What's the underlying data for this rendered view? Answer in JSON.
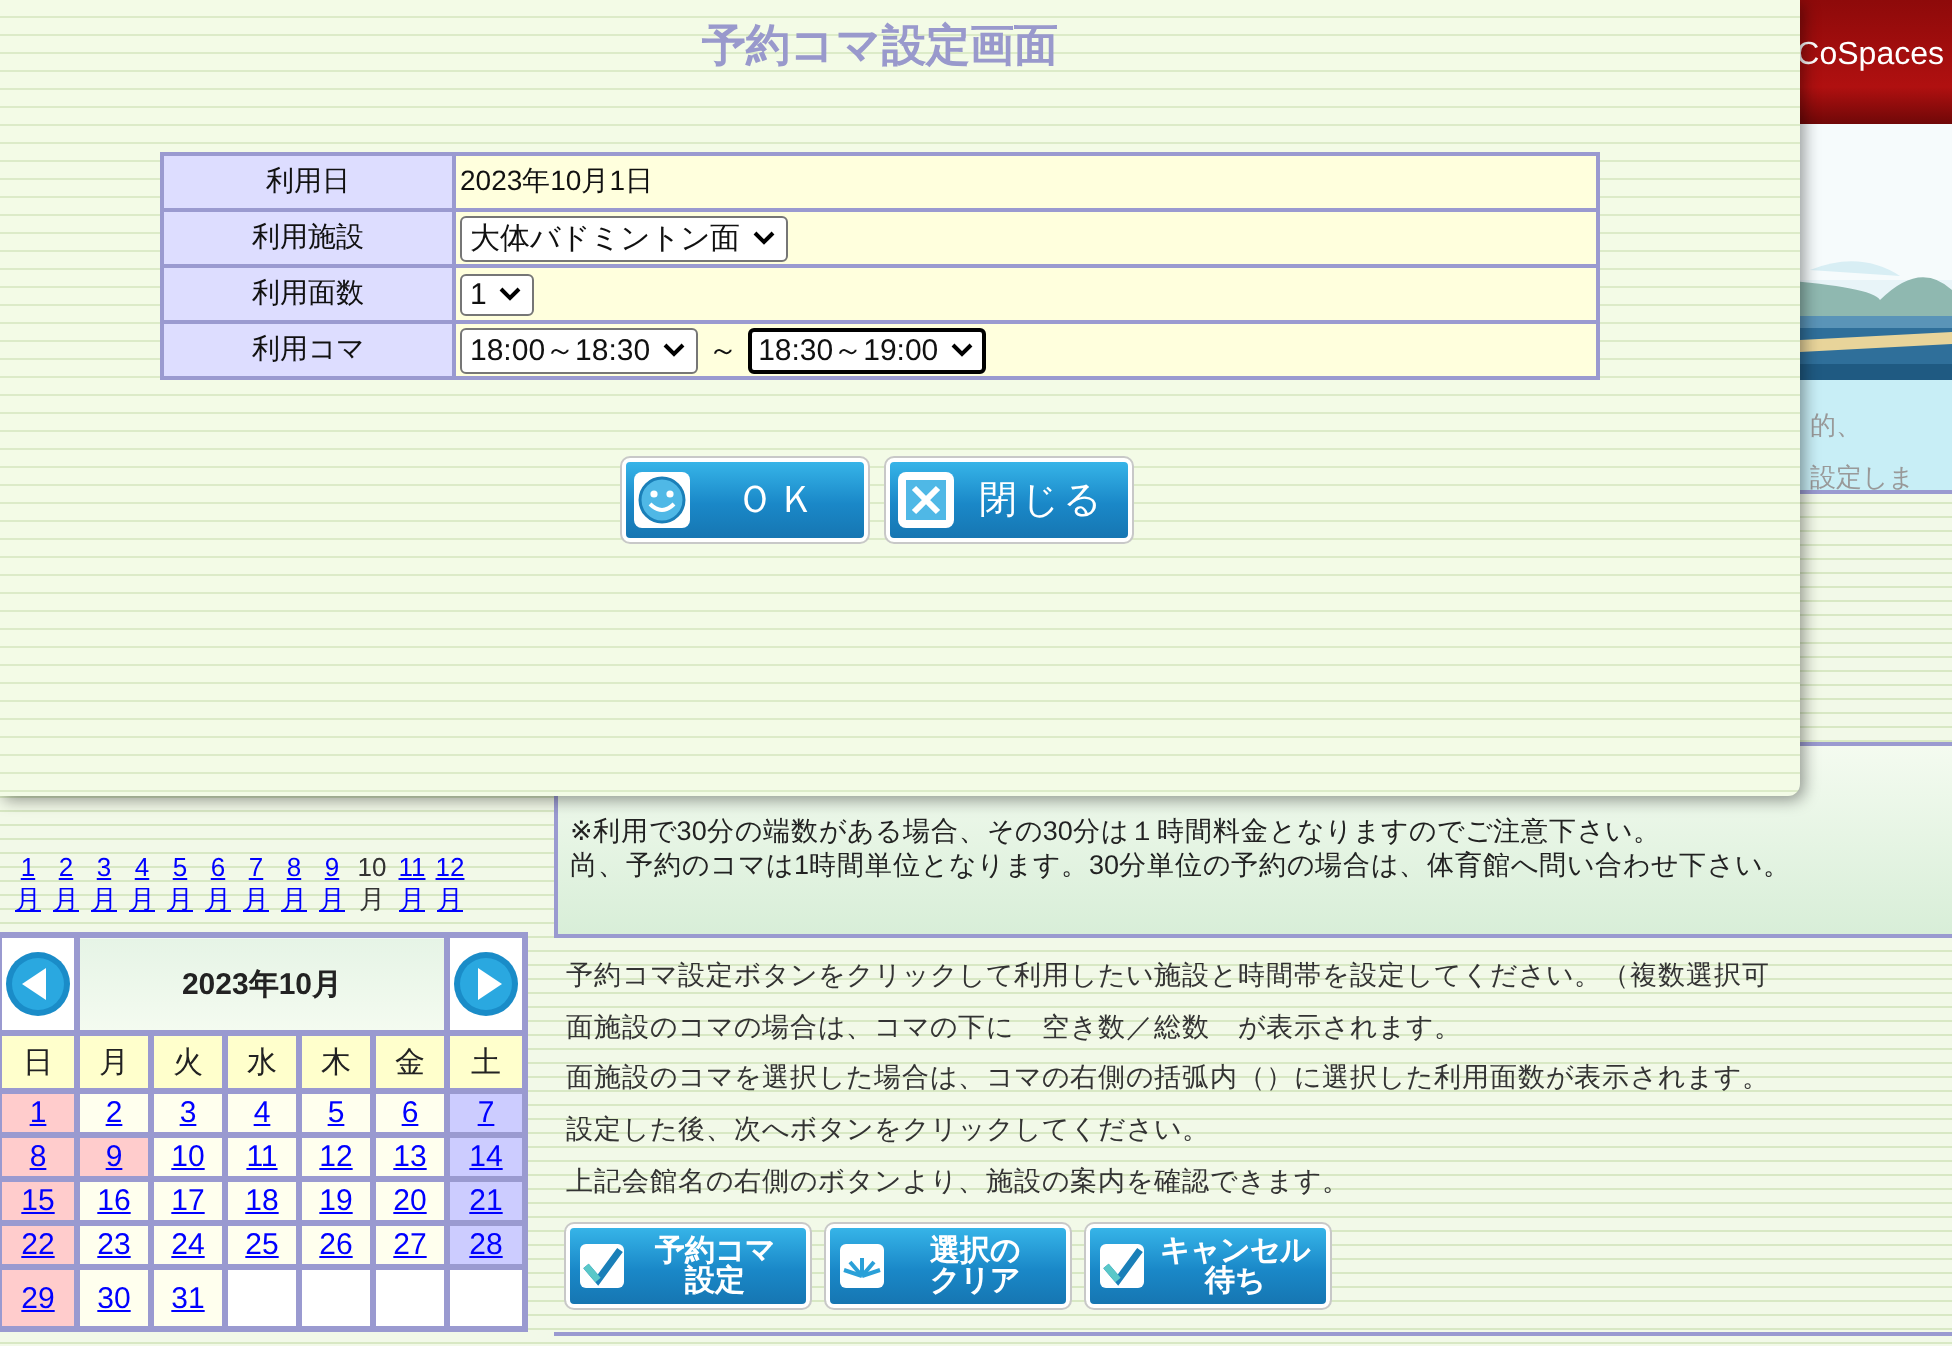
{
  "header": {
    "brand": "CoSpaces"
  },
  "notice": {
    "lines": [
      "的、",
      "設定しま"
    ]
  },
  "months": [
    {
      "label": "1月",
      "selected": false
    },
    {
      "label": "2月",
      "selected": false
    },
    {
      "label": "3月",
      "selected": false
    },
    {
      "label": "4月",
      "selected": false
    },
    {
      "label": "5月",
      "selected": false
    },
    {
      "label": "6月",
      "selected": false
    },
    {
      "label": "7月",
      "selected": false
    },
    {
      "label": "8月",
      "selected": false
    },
    {
      "label": "9月",
      "selected": false
    },
    {
      "label": "10月",
      "selected": true
    },
    {
      "label": "11月",
      "selected": false
    },
    {
      "label": "12月",
      "selected": false
    }
  ],
  "calendar": {
    "title": "2023年10月",
    "weekdays": [
      "日",
      "月",
      "火",
      "水",
      "木",
      "金",
      "土"
    ],
    "days": [
      {
        "label": "1",
        "kind": "holiday"
      },
      {
        "label": "2",
        "kind": "weekday"
      },
      {
        "label": "3",
        "kind": "weekday"
      },
      {
        "label": "4",
        "kind": "weekday"
      },
      {
        "label": "5",
        "kind": "weekday"
      },
      {
        "label": "6",
        "kind": "weekday"
      },
      {
        "label": "7",
        "kind": "saturday"
      },
      {
        "label": "8",
        "kind": "holiday"
      },
      {
        "label": "9",
        "kind": "holiday"
      },
      {
        "label": "10",
        "kind": "weekday"
      },
      {
        "label": "11",
        "kind": "weekday"
      },
      {
        "label": "12",
        "kind": "weekday"
      },
      {
        "label": "13",
        "kind": "weekday"
      },
      {
        "label": "14",
        "kind": "saturday"
      },
      {
        "label": "15",
        "kind": "holiday"
      },
      {
        "label": "16",
        "kind": "weekday"
      },
      {
        "label": "17",
        "kind": "weekday"
      },
      {
        "label": "18",
        "kind": "weekday"
      },
      {
        "label": "19",
        "kind": "weekday"
      },
      {
        "label": "20",
        "kind": "weekday"
      },
      {
        "label": "21",
        "kind": "saturday"
      },
      {
        "label": "22",
        "kind": "holiday"
      },
      {
        "label": "23",
        "kind": "weekday"
      },
      {
        "label": "24",
        "kind": "weekday"
      },
      {
        "label": "25",
        "kind": "weekday"
      },
      {
        "label": "26",
        "kind": "weekday"
      },
      {
        "label": "27",
        "kind": "weekday"
      },
      {
        "label": "28",
        "kind": "saturday"
      },
      {
        "label": "29",
        "kind": "holiday"
      },
      {
        "label": "30",
        "kind": "weekday"
      },
      {
        "label": "31",
        "kind": "weekday"
      }
    ]
  },
  "info_box": {
    "lines": [
      "※利用で30分の端数がある場合、その30分は１時間料金となりますのでご注意下さい。",
      "尚、予約のコマは1時間単位となります。30分単位の予約の場合は、体育館へ問い合わせ下さい。"
    ]
  },
  "instructions": [
    "予約コマ設定ボタンをクリックして利用したい施設と時間帯を設定してください。（複数選択可",
    "面施設のコマの場合は、コマの下に　空き数／総数　が表示されます。",
    "面施設のコマを選択した場合は、コマの右側の括弧内（）に選択した利用面数が表示されます。",
    "設定した後、次へボタンをクリックしてください。",
    "上記会館名の右側のボタンより、施設の案内を確認できます。"
  ],
  "actions": [
    {
      "label": "予約コマ設定",
      "kind": "check"
    },
    {
      "label": "選択のクリア",
      "kind": "burst"
    },
    {
      "label": "キャンセル待ち",
      "kind": "check"
    }
  ],
  "dialog": {
    "title": "予約コマ設定画面",
    "rows": [
      {
        "label": "利用日",
        "kind": "text",
        "value": "2023年10月1日"
      },
      {
        "label": "利用施設",
        "kind": "select",
        "selects": [
          {
            "value": "大体バドミントン面",
            "focused": false
          }
        ]
      },
      {
        "label": "利用面数",
        "kind": "select",
        "selects": [
          {
            "value": "1",
            "focused": false
          }
        ]
      },
      {
        "label": "利用コマ",
        "kind": "range",
        "separator": "～",
        "selects": [
          {
            "value": "18:00～18:30",
            "focused": false
          },
          {
            "value": "18:30～19:00",
            "focused": true
          }
        ]
      }
    ],
    "buttons": [
      {
        "label": "ＯＫ",
        "kind": "ok"
      },
      {
        "label": "閉じる",
        "kind": "close"
      }
    ]
  }
}
